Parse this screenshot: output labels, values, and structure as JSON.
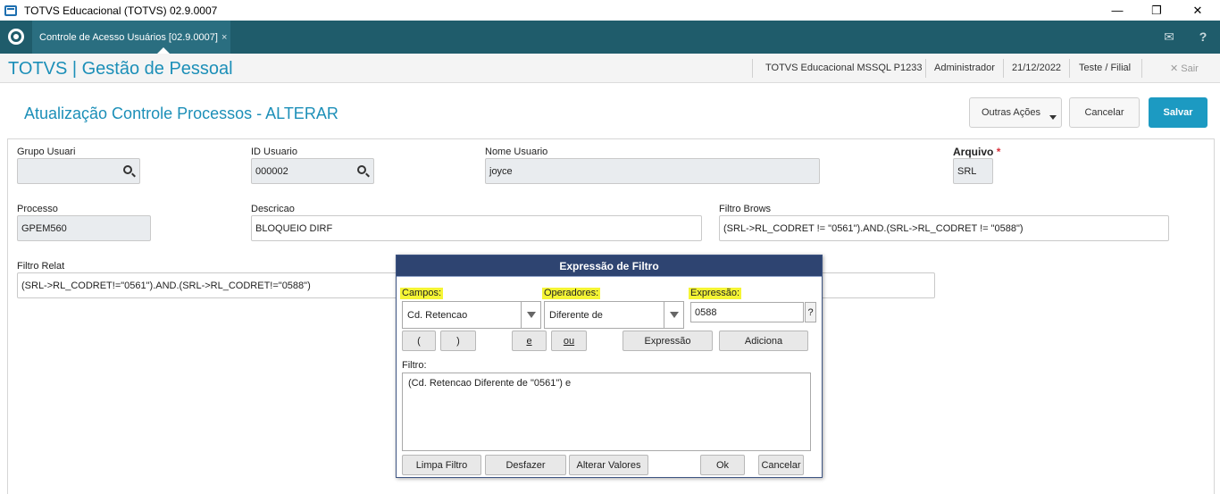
{
  "window": {
    "title": "TOTVS Educacional (TOTVS) 02.9.0007",
    "minimize": "—",
    "restore": "❐",
    "close": "✕"
  },
  "tabbar": {
    "tab_label": "Controle de Acesso Usuários [02.9.0007]",
    "tab_close": "×",
    "mail_icon": "✉",
    "help_icon": "?"
  },
  "header": {
    "brand": "TOTVS | Gestão de Pessoal",
    "environment": "TOTVS Educacional MSSQL P1233",
    "user": "Administrador",
    "date": "21/12/2022",
    "branch": "Teste / Filial",
    "exit_label": "✕  Sair"
  },
  "page": {
    "title": "Atualização Controle Processos - ALTERAR",
    "other_actions": "Outras Ações",
    "cancel": "Cancelar",
    "save": "Salvar"
  },
  "form": {
    "grupo_usuari_label": "Grupo Usuari",
    "grupo_usuari_value": "",
    "id_usuario_label": "ID Usuario",
    "id_usuario_value": "000002",
    "nome_usuario_label": "Nome Usuario",
    "nome_usuario_value": "joyce",
    "arquivo_label": "Arquivo",
    "arquivo_required": "*",
    "arquivo_value": "SRL",
    "processo_label": "Processo",
    "processo_value": "GPEM560",
    "descricao_label": "Descricao",
    "descricao_value": "BLOQUEIO DIRF",
    "filtro_brows_label": "Filtro Brows",
    "filtro_brows_value": "(SRL->RL_CODRET != \"0561\").AND.(SRL->RL_CODRET != \"0588\")",
    "filtro_relat_label": "Filtro Relat",
    "filtro_relat_value": "(SRL->RL_CODRET!=\"0561\").AND.(SRL->RL_CODRET!=\"0588\")"
  },
  "dialog": {
    "title": "Expressão de Filtro",
    "campos_label": "Campos:",
    "campos_value": "Cd. Retencao",
    "operadores_label": "Operadores:",
    "operadores_value": "Diferente de",
    "expressao_label": "Expressão:",
    "expressao_value": "0588",
    "help_btn": "?",
    "open_paren": "(",
    "close_paren": ")",
    "and_btn": "e",
    "or_btn": "ou",
    "expressao_btn": "Expressão",
    "adiciona_btn": "Adiciona",
    "filtro_label": "Filtro:",
    "filtro_value": "(Cd. Retencao Diferente de  \"0561\") e",
    "limpa_filtro": "Limpa Filtro",
    "desfazer": "Desfazer",
    "alterar_valores": "Alterar Valores",
    "ok": "Ok",
    "cancelar": "Cancelar"
  },
  "colors": {
    "accent": "#1c8fb8",
    "tabbar": "#1f5c6b",
    "dialog_title": "#2e4471",
    "highlight": "#f5f535",
    "primary_button": "#1c9ac2"
  }
}
